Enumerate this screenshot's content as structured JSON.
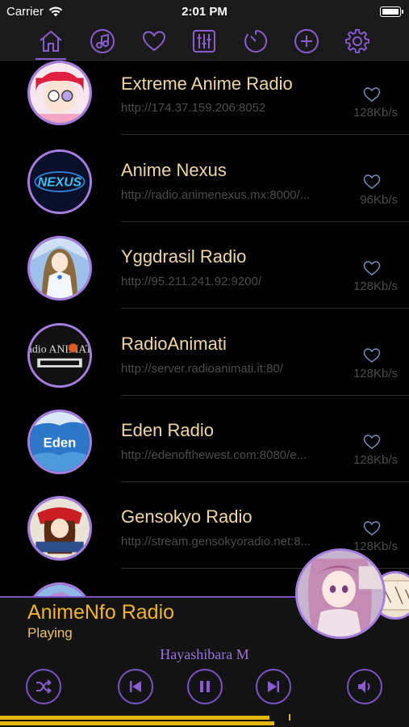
{
  "status_bar": {
    "carrier": "Carrier",
    "time": "2:01 PM"
  },
  "nav": {
    "tabs": [
      {
        "icon": "home-icon"
      },
      {
        "icon": "music-note-icon"
      },
      {
        "icon": "heart-icon"
      },
      {
        "icon": "equalizer-icon"
      },
      {
        "icon": "timer-icon"
      },
      {
        "icon": "add-icon"
      },
      {
        "icon": "gear-icon"
      }
    ],
    "active_index": 0
  },
  "stations": [
    {
      "name": "Extreme Anime Radio",
      "url": "http://174.37.159.206:8052",
      "bitrate": "128Kb/s"
    },
    {
      "name": "Anime Nexus",
      "url": "http://radio.animenexus.mx:8000/...",
      "bitrate": "96Kb/s",
      "logo_text": "NEXUS"
    },
    {
      "name": "Yggdrasil Radio",
      "url": "http://95.211.241.92:9200/",
      "bitrate": "128Kb/s"
    },
    {
      "name": "RadioAnimati",
      "url": "http://server.radioanimati.it:80/",
      "bitrate": "128Kb/s",
      "logo_text": "radio ANIMATI"
    },
    {
      "name": "Eden Radio",
      "url": "http://edenofthewest.com:8080/e...",
      "bitrate": "128Kb/s",
      "logo_text": "Eden"
    },
    {
      "name": "Gensokyo Radio",
      "url": "http://stream.gensokyoradio.net:8...",
      "bitrate": "128Kb/s"
    }
  ],
  "now_playing": {
    "title": "AnimeNfo Radio",
    "status": "Playing",
    "artist": "Hayashibara M"
  },
  "colors": {
    "accent": "#7a52c4",
    "station_name": "#f0d7a4",
    "now_playing_title": "#f1b42f",
    "level": "#e4b70f"
  }
}
